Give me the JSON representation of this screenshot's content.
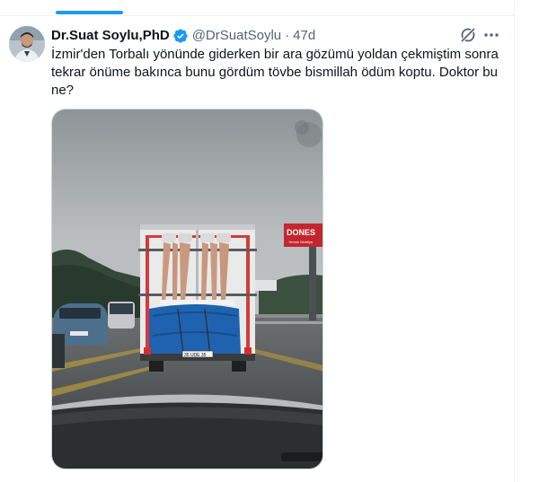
{
  "tweet": {
    "author_name": "Dr.Suat Soylu,PhD",
    "handle": "@DrSuatSoylu",
    "separator": "·",
    "time": "47d",
    "text": "İzmir'den Torbalı yönünde giderken bir ara gözümü yoldan çekmiştim sonra tekrar önüme bakınca bunu gördüm tövbe bismillah ödüm koptu. Doktor bu ne?",
    "media": {
      "billboard_text": "DONES",
      "billboard_subtext": "Yemek Mobilya",
      "plate_text": "35 UDE 35"
    }
  },
  "colors": {
    "accent": "#1d9bf0",
    "text_primary": "#0f1419",
    "text_secondary": "#536471",
    "divider": "#eff3f4"
  },
  "icons": {
    "verified": "verified-badge-icon",
    "grok": "grok-icon",
    "more": "more-horizontal-icon"
  }
}
